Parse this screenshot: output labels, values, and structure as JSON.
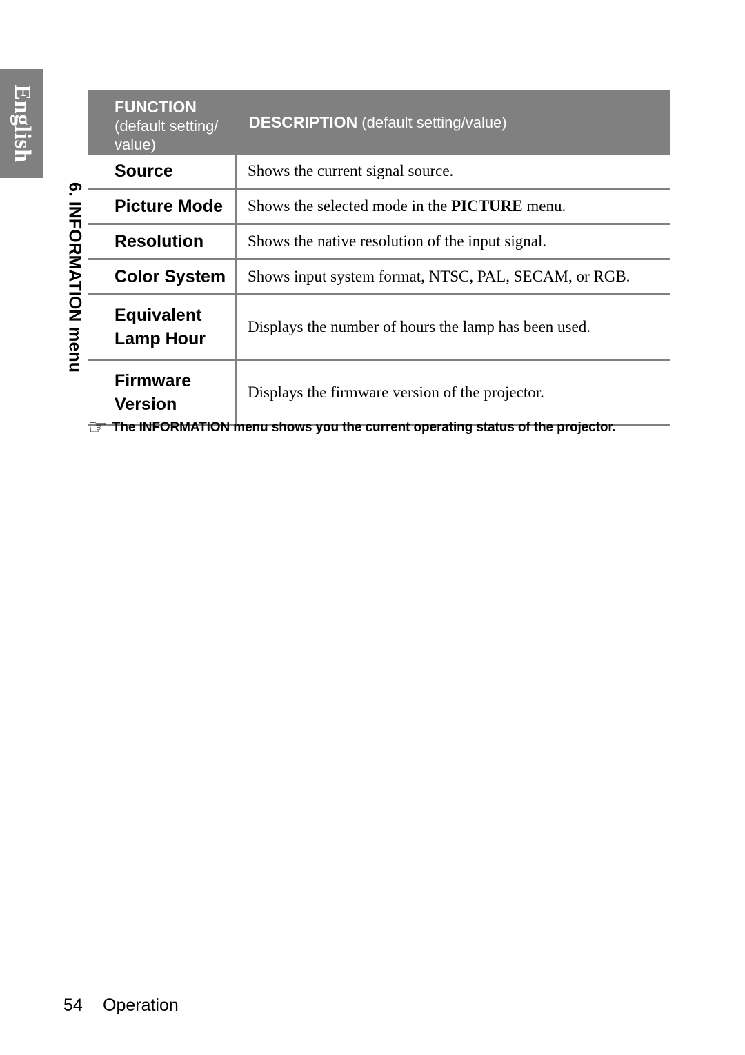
{
  "language_tab": {
    "label": "English"
  },
  "section_label": {
    "text": "6. INFORMATION menu"
  },
  "table": {
    "header": {
      "function_title": "FUNCTION",
      "function_subtitle_line1": "(default setting/",
      "function_subtitle_line2": "value)",
      "description_title": "DESCRIPTION",
      "description_subtitle": " (default setting/value)"
    },
    "rows": [
      {
        "function": "Source",
        "description_pre": "Shows the current signal source.",
        "description_emph": "",
        "description_post": ""
      },
      {
        "function": "Picture Mode",
        "description_pre": "Shows the selected mode in the ",
        "description_emph": "PICTURE",
        "description_post": " menu."
      },
      {
        "function": "Resolution",
        "description_pre": "Shows the native resolution of the input signal.",
        "description_emph": "",
        "description_post": ""
      },
      {
        "function": "Color System",
        "description_pre": "Shows input system format, NTSC, PAL, SECAM, or RGB.",
        "description_emph": "",
        "description_post": ""
      },
      {
        "function": "Equivalent\nLamp Hour",
        "description_pre": "Displays the number of hours the lamp has been used.",
        "description_emph": "",
        "description_post": ""
      },
      {
        "function": "Firmware\nVersion",
        "description_pre": "Displays the firmware version of the projector.",
        "description_emph": "",
        "description_post": ""
      }
    ]
  },
  "note": {
    "icon": "pointing-hand-icon",
    "glyph": "☞",
    "text": "The INFORMATION menu shows you the current operating status of the projector."
  },
  "footer": {
    "page_number": "54",
    "section_name": "Operation"
  },
  "colors": {
    "header_gray": "#808080",
    "rule_gray": "#808080",
    "text_black": "#000000",
    "header_text": "#ffffff"
  }
}
